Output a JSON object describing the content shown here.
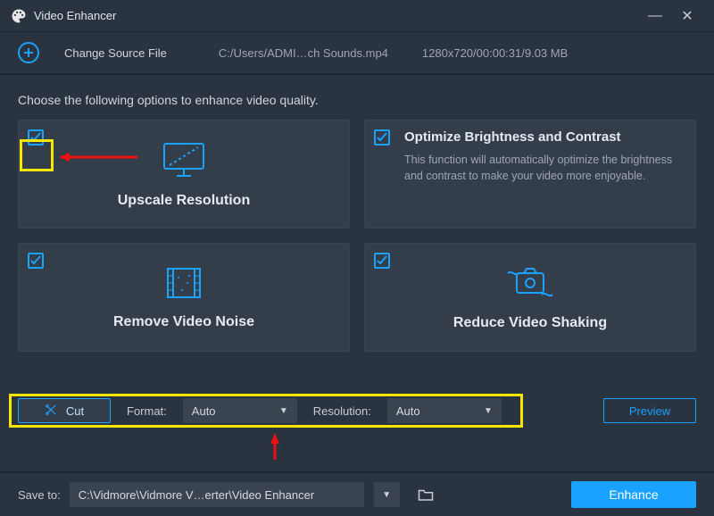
{
  "window": {
    "title": "Video Enhancer",
    "minimize": "—",
    "close": "✕"
  },
  "source": {
    "change_label": "Change Source File",
    "path": "C:/Users/ADMI…ch Sounds.mp4",
    "meta": "1280x720/00:00:31/9.03 MB"
  },
  "instruction": "Choose the following options to enhance video quality.",
  "cards": {
    "upscale": {
      "title": "Upscale Resolution"
    },
    "brightness": {
      "title": "Optimize Brightness and Contrast",
      "desc": "This function will automatically optimize the brightness and contrast to make your video more enjoyable."
    },
    "noise": {
      "title": "Remove Video Noise"
    },
    "shaking": {
      "title": "Reduce Video Shaking"
    }
  },
  "controls": {
    "cut_label": "Cut",
    "format_label": "Format:",
    "format_value": "Auto",
    "resolution_label": "Resolution:",
    "resolution_value": "Auto",
    "preview_label": "Preview"
  },
  "bottom": {
    "saveto_label": "Save to:",
    "path": "C:\\Vidmore\\Vidmore V…erter\\Video Enhancer",
    "enhance_label": "Enhance"
  },
  "colors": {
    "accent": "#19a2ff",
    "highlight": "#f7e600",
    "arrow": "#e11"
  }
}
